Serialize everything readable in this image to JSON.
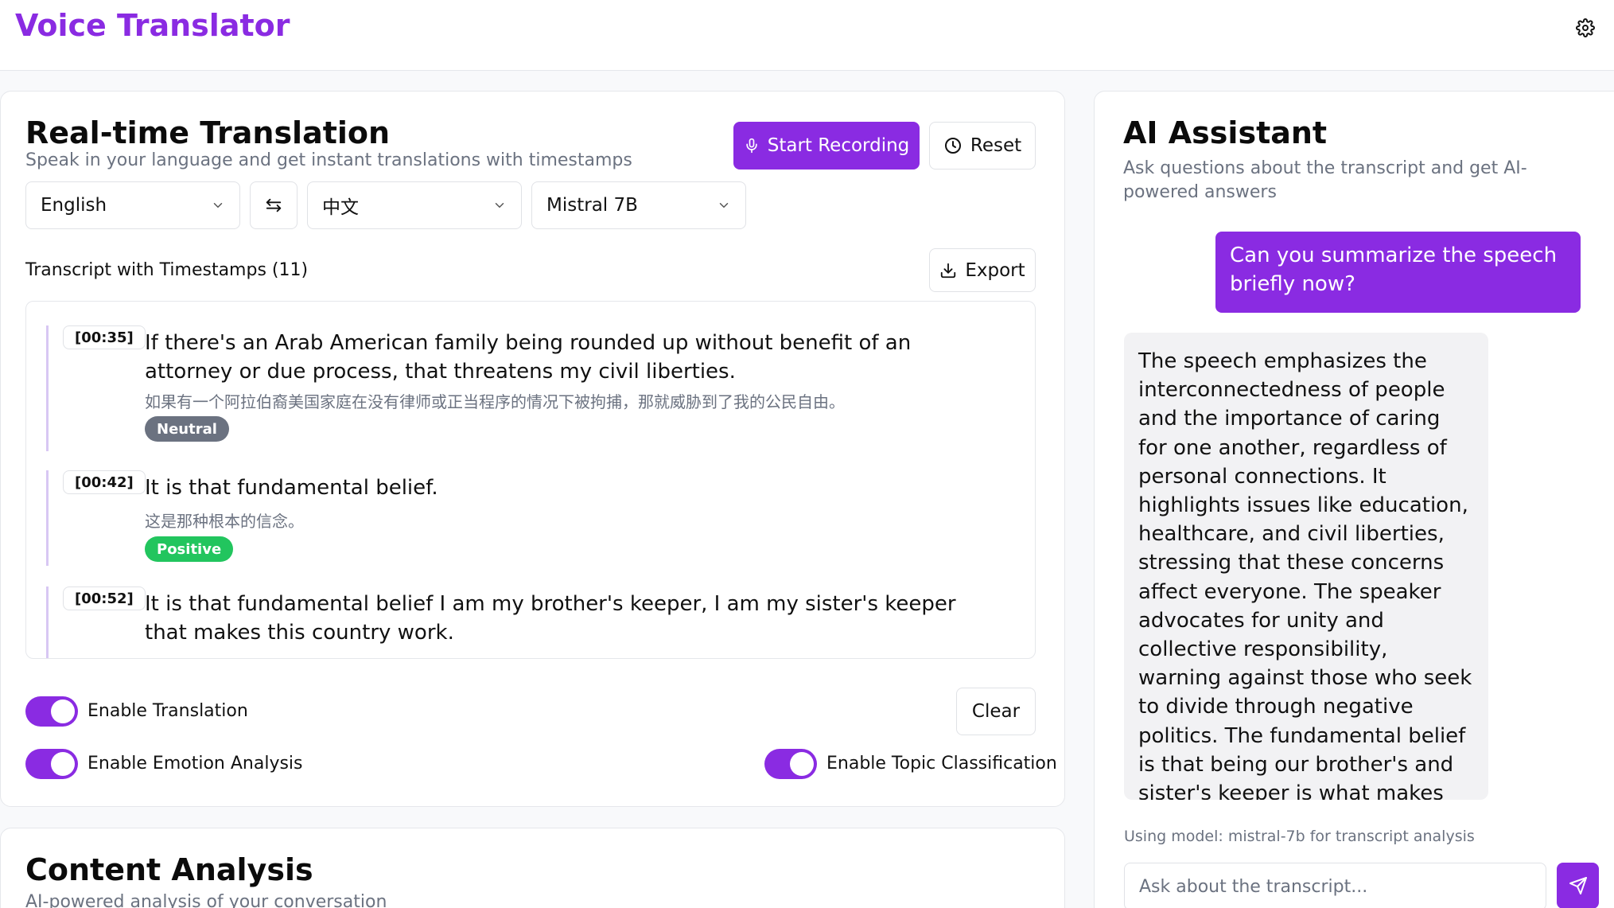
{
  "app": {
    "title": "Voice Translator"
  },
  "translation": {
    "title": "Real-time Translation",
    "subtitle": "Speak in your language and get instant translations with timestamps",
    "start_label": "Start Recording",
    "reset_label": "Reset",
    "source_language": "English",
    "target_language": "中文",
    "model": "Mistral 7B",
    "transcript_heading": "Transcript with Timestamps (11)",
    "export_label": "Export",
    "entries": [
      {
        "time": "[00:35]",
        "text": "If there's an Arab American family being rounded up without benefit of an attorney or due process, that threatens my civil liberties.",
        "translation": "如果有一个阿拉伯裔美国家庭在没有律师或正当程序的情况下被拘捕，那就威胁到了我的公民自由。",
        "sentiment": "Neutral"
      },
      {
        "time": "[00:42]",
        "text": "It is that fundamental belief.",
        "translation": "这是那种根本的信念。",
        "sentiment": "Positive"
      },
      {
        "time": "[00:52]",
        "text": "It is that fundamental belief I am my brother's keeper, I am my sister's keeper that makes this country work.",
        "translation": "",
        "sentiment": ""
      }
    ],
    "toggles": {
      "translation": "Enable Translation",
      "emotion": "Enable Emotion Analysis",
      "topic": "Enable Topic Classification"
    },
    "clear_label": "Clear"
  },
  "analysis": {
    "title": "Content Analysis",
    "subtitle": "AI-powered analysis of your conversation"
  },
  "assistant": {
    "title": "AI Assistant",
    "subtitle": "Ask questions about the transcript and get AI-powered answers",
    "user_message": "Can you summarize the speech briefly now?",
    "ai_message": "The speech emphasizes the interconnectedness of people and the importance of caring for one another, regardless of personal connections. It highlights issues like education, healthcare, and civil liberties, stressing that these concerns affect everyone. The speaker advocates for unity and collective responsibility, warning against those who seek to divide through negative politics. The fundamental belief is that being our brother's and sister's keeper is what makes the country function and allows individuals to pursue their",
    "model_note": "Using model: mistral-7b for transcript analysis",
    "input_placeholder": "Ask about the transcript..."
  },
  "colors": {
    "accent": "#8a2be2",
    "neutral_badge": "#6b7280",
    "positive_badge": "#22c55e"
  },
  "icons": {
    "settings": "gear-icon",
    "microphone": "mic-icon",
    "reset": "clock-icon",
    "swap": "swap-icon",
    "export": "download-icon",
    "send": "send-icon",
    "dropdown": "chevron-down-icon"
  }
}
